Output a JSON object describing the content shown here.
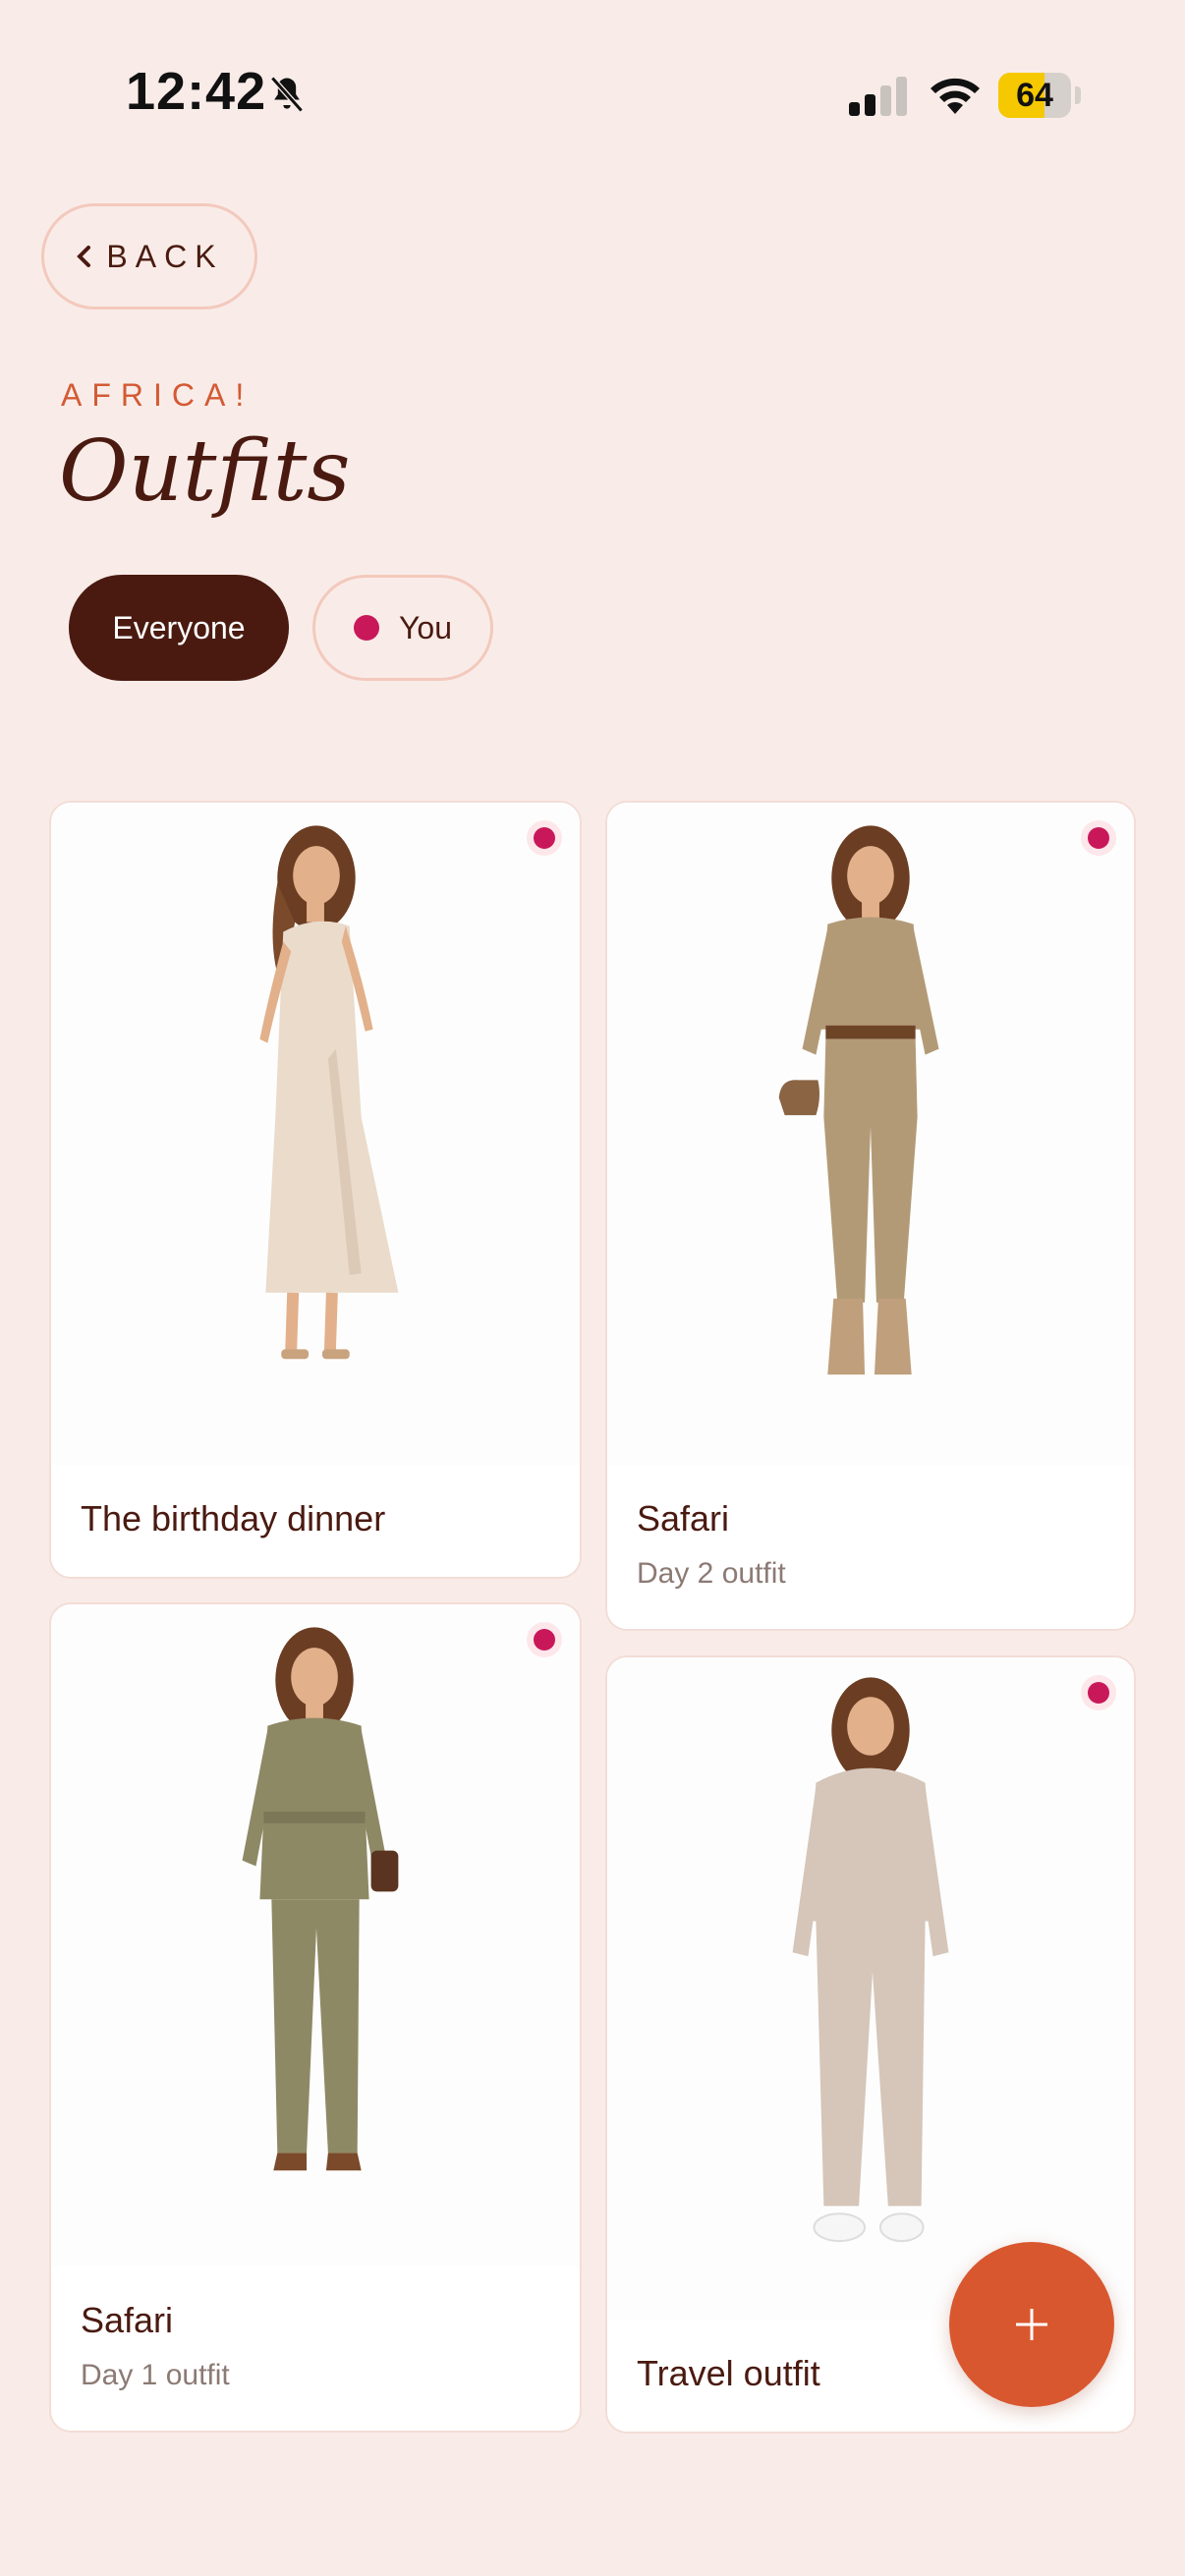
{
  "status": {
    "time": "12:42",
    "battery": "64",
    "battery_level": 0.64
  },
  "header": {
    "back_label": "BACK",
    "eyebrow": "AFRICA!",
    "title": "Outfits"
  },
  "filters": [
    {
      "label": "Everyone",
      "selected": true
    },
    {
      "label": "You",
      "selected": false
    }
  ],
  "colors": {
    "accent": "#d9572f",
    "dark": "#4a1a10",
    "owner_dot": "#c8185a",
    "background": "#f9ece8"
  },
  "outfits": [
    {
      "title": "The birthday dinner",
      "subtitle": "",
      "image": "champagne one-shoulder wrap dress"
    },
    {
      "title": "Safari",
      "subtitle": "Day 2 outfit",
      "image": "khaki utility jumpsuit with belt"
    },
    {
      "title": "Safari",
      "subtitle": "Day 1 outfit",
      "image": "olive belted shirt jacket and trousers"
    },
    {
      "title": "Travel outfit",
      "subtitle": "",
      "image": "taupe hoodie and joggers"
    }
  ],
  "fab": {
    "icon": "plus-icon"
  }
}
